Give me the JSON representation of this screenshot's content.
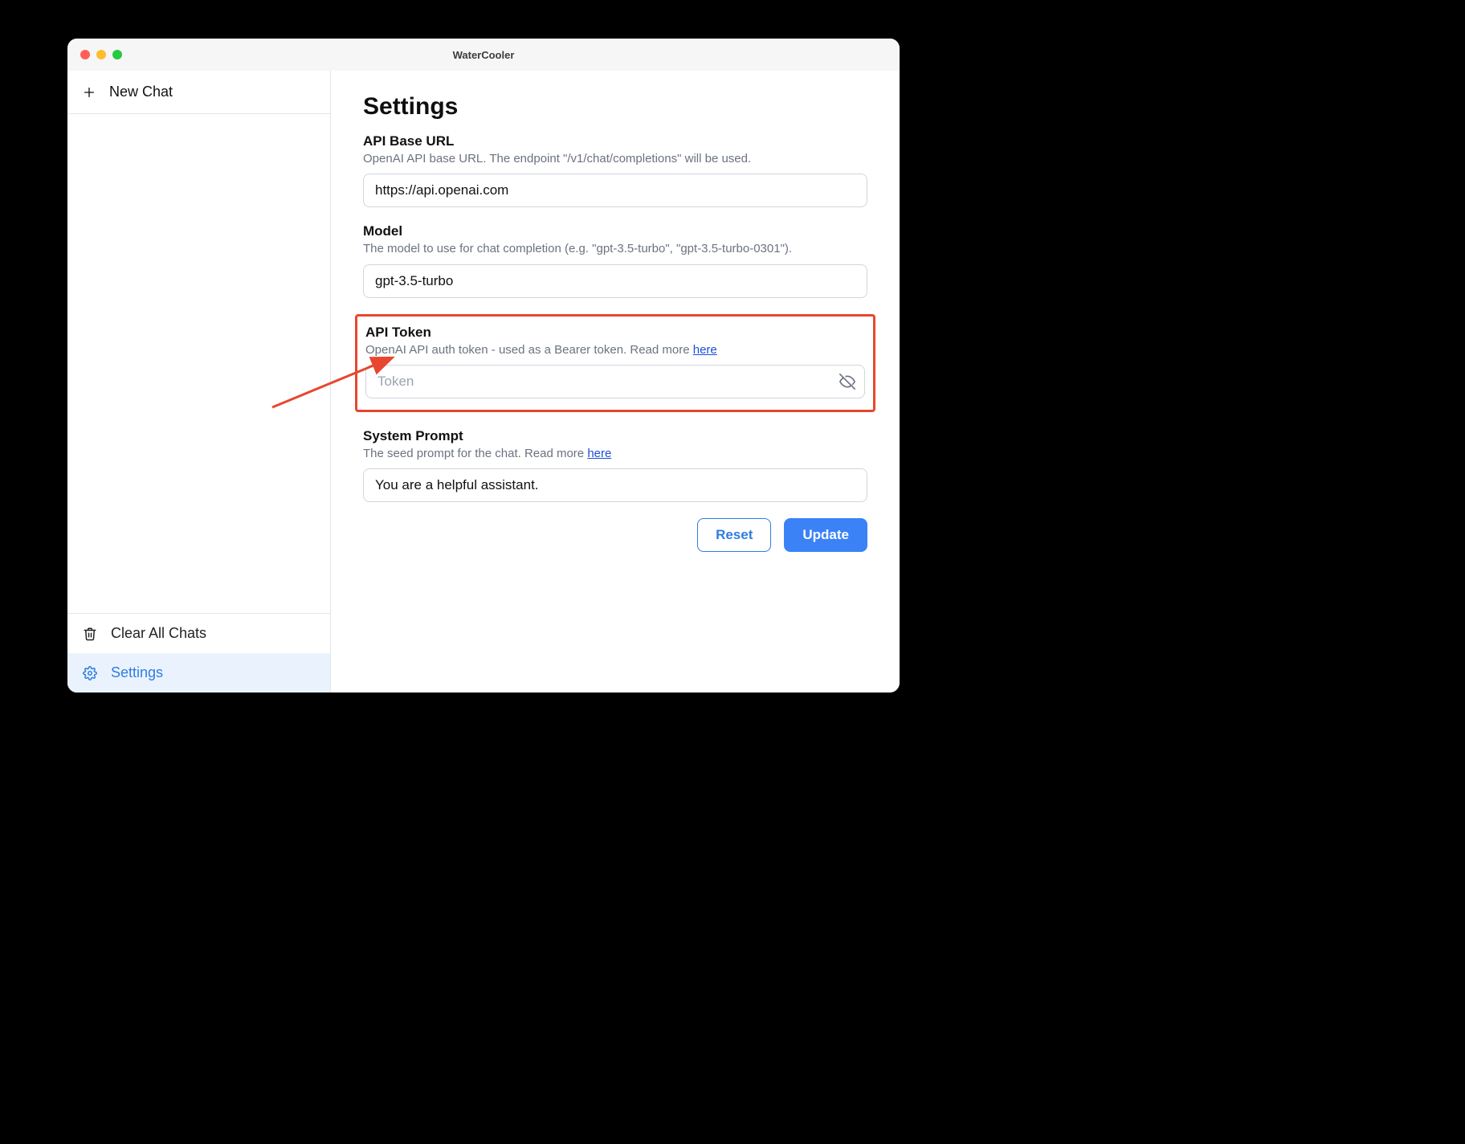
{
  "window": {
    "title": "WaterCooler"
  },
  "sidebar": {
    "new_chat_label": "New Chat",
    "clear_all_label": "Clear All Chats",
    "settings_label": "Settings"
  },
  "settings": {
    "heading": "Settings",
    "fields": {
      "api_base_url": {
        "label": "API Base URL",
        "description": "OpenAI API base URL. The endpoint \"/v1/chat/completions\" will be used.",
        "value": "https://api.openai.com"
      },
      "model": {
        "label": "Model",
        "description": "The model to use for chat completion (e.g. \"gpt-3.5-turbo\", \"gpt-3.5-turbo-0301\").",
        "value": "gpt-3.5-turbo"
      },
      "api_token": {
        "label": "API Token",
        "description_prefix": "OpenAI API auth token - used as a Bearer token. Read more ",
        "link_text": "here",
        "placeholder": "Token",
        "value": ""
      },
      "system_prompt": {
        "label": "System Prompt",
        "description_prefix": "The seed prompt for the chat. Read more ",
        "link_text": "here",
        "value": "You are a helpful assistant."
      }
    },
    "buttons": {
      "reset": "Reset",
      "update": "Update"
    }
  }
}
